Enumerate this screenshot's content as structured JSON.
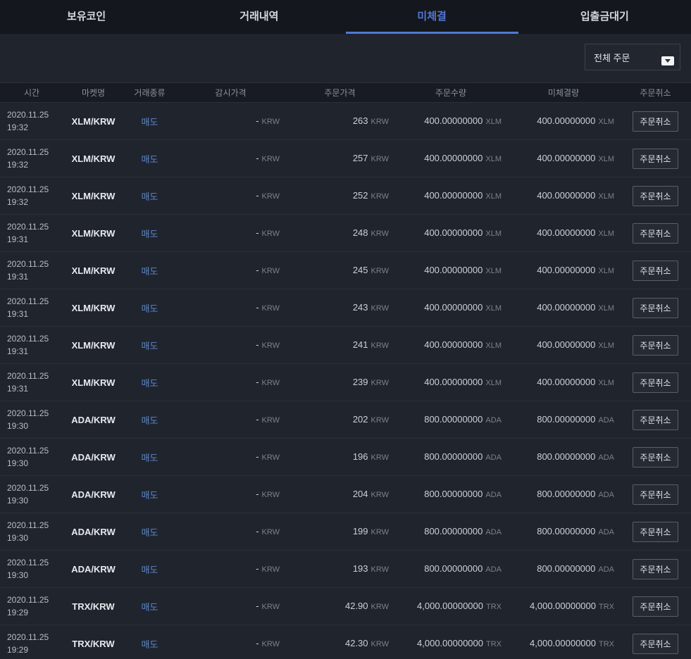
{
  "tabs": [
    {
      "label": "보유코인",
      "active": false
    },
    {
      "label": "거래내역",
      "active": false
    },
    {
      "label": "미체결",
      "active": true
    },
    {
      "label": "입출금대기",
      "active": false
    }
  ],
  "filter": {
    "selected": "전체 주문"
  },
  "colors": {
    "accent": "#5377d6",
    "sell": "#5d87c9",
    "background": "#20242d",
    "topbar": "#14171d"
  },
  "table": {
    "headers": [
      "시간",
      "마켓명",
      "거래종류",
      "감시가격",
      "주문가격",
      "주문수량",
      "미체결량",
      "주문취소"
    ],
    "cancel_label": "주문취소",
    "rows": [
      {
        "date": "2020.11.25",
        "time": "19:32",
        "market": "XLM/KRW",
        "side": "매도",
        "watch_price": "-",
        "watch_unit": "KRW",
        "order_price": "263",
        "price_unit": "KRW",
        "qty": "400.00000000",
        "qty_unit": "XLM",
        "unfilled": "400.00000000",
        "unfilled_unit": "XLM"
      },
      {
        "date": "2020.11.25",
        "time": "19:32",
        "market": "XLM/KRW",
        "side": "매도",
        "watch_price": "-",
        "watch_unit": "KRW",
        "order_price": "257",
        "price_unit": "KRW",
        "qty": "400.00000000",
        "qty_unit": "XLM",
        "unfilled": "400.00000000",
        "unfilled_unit": "XLM"
      },
      {
        "date": "2020.11.25",
        "time": "19:32",
        "market": "XLM/KRW",
        "side": "매도",
        "watch_price": "-",
        "watch_unit": "KRW",
        "order_price": "252",
        "price_unit": "KRW",
        "qty": "400.00000000",
        "qty_unit": "XLM",
        "unfilled": "400.00000000",
        "unfilled_unit": "XLM"
      },
      {
        "date": "2020.11.25",
        "time": "19:31",
        "market": "XLM/KRW",
        "side": "매도",
        "watch_price": "-",
        "watch_unit": "KRW",
        "order_price": "248",
        "price_unit": "KRW",
        "qty": "400.00000000",
        "qty_unit": "XLM",
        "unfilled": "400.00000000",
        "unfilled_unit": "XLM"
      },
      {
        "date": "2020.11.25",
        "time": "19:31",
        "market": "XLM/KRW",
        "side": "매도",
        "watch_price": "-",
        "watch_unit": "KRW",
        "order_price": "245",
        "price_unit": "KRW",
        "qty": "400.00000000",
        "qty_unit": "XLM",
        "unfilled": "400.00000000",
        "unfilled_unit": "XLM"
      },
      {
        "date": "2020.11.25",
        "time": "19:31",
        "market": "XLM/KRW",
        "side": "매도",
        "watch_price": "-",
        "watch_unit": "KRW",
        "order_price": "243",
        "price_unit": "KRW",
        "qty": "400.00000000",
        "qty_unit": "XLM",
        "unfilled": "400.00000000",
        "unfilled_unit": "XLM"
      },
      {
        "date": "2020.11.25",
        "time": "19:31",
        "market": "XLM/KRW",
        "side": "매도",
        "watch_price": "-",
        "watch_unit": "KRW",
        "order_price": "241",
        "price_unit": "KRW",
        "qty": "400.00000000",
        "qty_unit": "XLM",
        "unfilled": "400.00000000",
        "unfilled_unit": "XLM"
      },
      {
        "date": "2020.11.25",
        "time": "19:31",
        "market": "XLM/KRW",
        "side": "매도",
        "watch_price": "-",
        "watch_unit": "KRW",
        "order_price": "239",
        "price_unit": "KRW",
        "qty": "400.00000000",
        "qty_unit": "XLM",
        "unfilled": "400.00000000",
        "unfilled_unit": "XLM"
      },
      {
        "date": "2020.11.25",
        "time": "19:30",
        "market": "ADA/KRW",
        "side": "매도",
        "watch_price": "-",
        "watch_unit": "KRW",
        "order_price": "202",
        "price_unit": "KRW",
        "qty": "800.00000000",
        "qty_unit": "ADA",
        "unfilled": "800.00000000",
        "unfilled_unit": "ADA"
      },
      {
        "date": "2020.11.25",
        "time": "19:30",
        "market": "ADA/KRW",
        "side": "매도",
        "watch_price": "-",
        "watch_unit": "KRW",
        "order_price": "196",
        "price_unit": "KRW",
        "qty": "800.00000000",
        "qty_unit": "ADA",
        "unfilled": "800.00000000",
        "unfilled_unit": "ADA"
      },
      {
        "date": "2020.11.25",
        "time": "19:30",
        "market": "ADA/KRW",
        "side": "매도",
        "watch_price": "-",
        "watch_unit": "KRW",
        "order_price": "204",
        "price_unit": "KRW",
        "qty": "800.00000000",
        "qty_unit": "ADA",
        "unfilled": "800.00000000",
        "unfilled_unit": "ADA"
      },
      {
        "date": "2020.11.25",
        "time": "19:30",
        "market": "ADA/KRW",
        "side": "매도",
        "watch_price": "-",
        "watch_unit": "KRW",
        "order_price": "199",
        "price_unit": "KRW",
        "qty": "800.00000000",
        "qty_unit": "ADA",
        "unfilled": "800.00000000",
        "unfilled_unit": "ADA"
      },
      {
        "date": "2020.11.25",
        "time": "19:30",
        "market": "ADA/KRW",
        "side": "매도",
        "watch_price": "-",
        "watch_unit": "KRW",
        "order_price": "193",
        "price_unit": "KRW",
        "qty": "800.00000000",
        "qty_unit": "ADA",
        "unfilled": "800.00000000",
        "unfilled_unit": "ADA"
      },
      {
        "date": "2020.11.25",
        "time": "19:29",
        "market": "TRX/KRW",
        "side": "매도",
        "watch_price": "-",
        "watch_unit": "KRW",
        "order_price": "42.90",
        "price_unit": "KRW",
        "qty": "4,000.00000000",
        "qty_unit": "TRX",
        "unfilled": "4,000.00000000",
        "unfilled_unit": "TRX"
      },
      {
        "date": "2020.11.25",
        "time": "19:29",
        "market": "TRX/KRW",
        "side": "매도",
        "watch_price": "-",
        "watch_unit": "KRW",
        "order_price": "42.30",
        "price_unit": "KRW",
        "qty": "4,000.00000000",
        "qty_unit": "TRX",
        "unfilled": "4,000.00000000",
        "unfilled_unit": "TRX"
      }
    ]
  }
}
